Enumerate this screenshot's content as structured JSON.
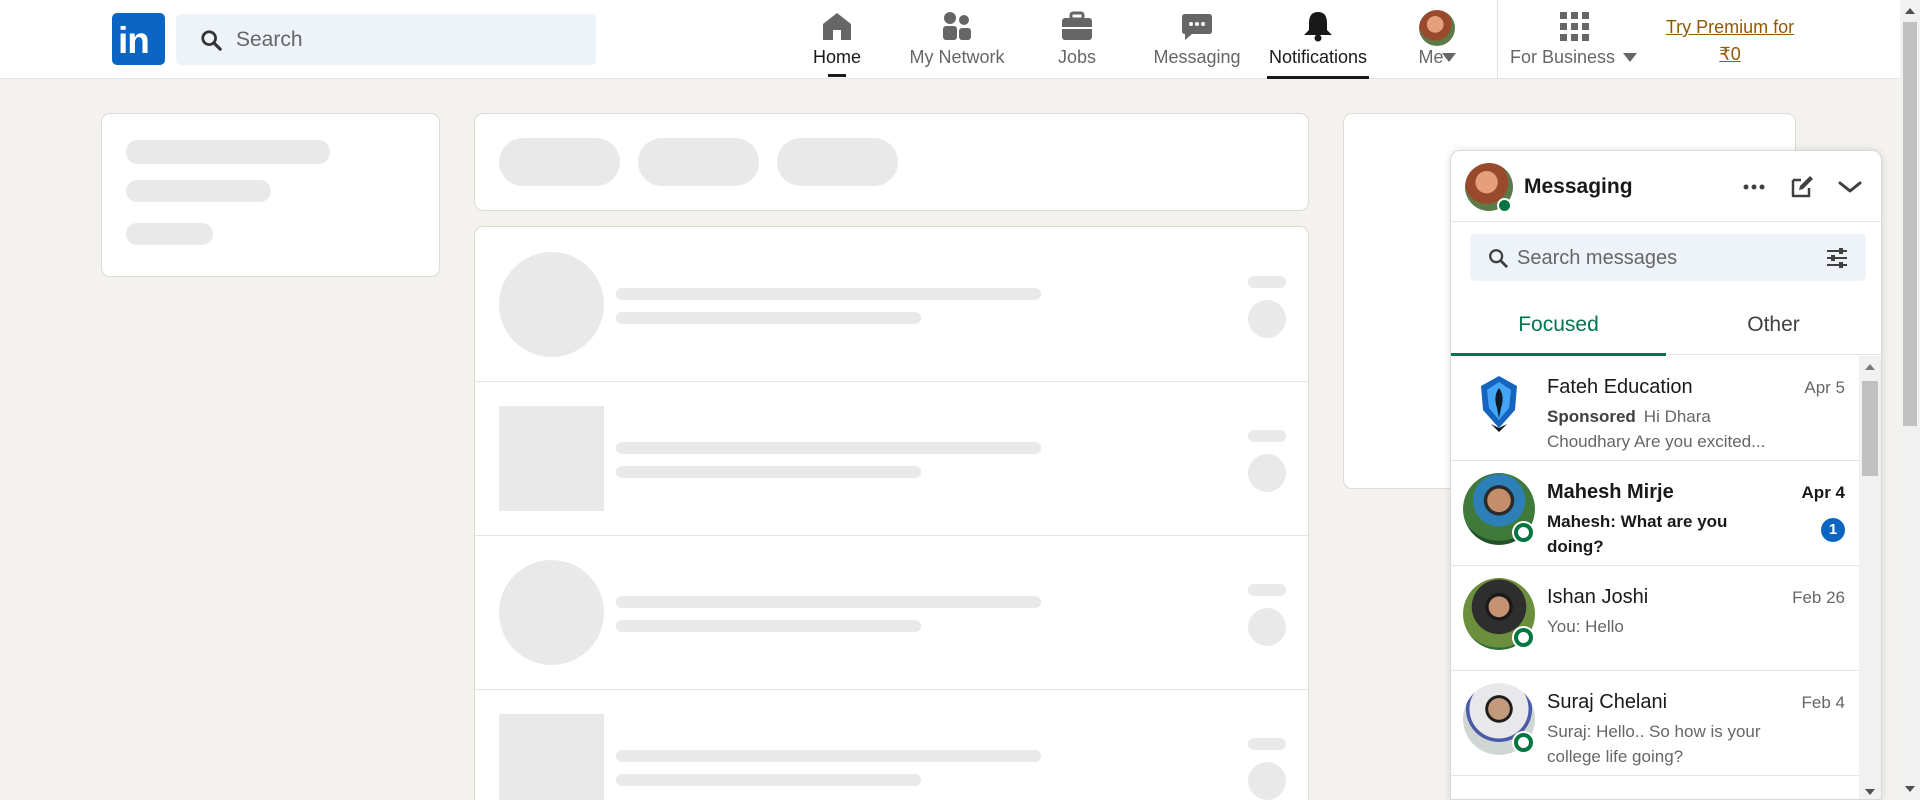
{
  "header": {
    "logo_text": "in",
    "search_placeholder": "Search",
    "nav": [
      {
        "label": "Home",
        "icon": "home-icon"
      },
      {
        "label": "My Network",
        "icon": "people-icon"
      },
      {
        "label": "Jobs",
        "icon": "briefcase-icon"
      },
      {
        "label": "Messaging",
        "icon": "chat-icon"
      },
      {
        "label": "Notifications",
        "icon": "bell-icon"
      },
      {
        "label": "Me",
        "icon": "avatar"
      },
      {
        "label": "For Business",
        "icon": "grid-icon"
      }
    ],
    "premium_line1": "Try Premium for",
    "premium_line2": "₹0"
  },
  "messaging": {
    "title": "Messaging",
    "search_placeholder": "Search messages",
    "tabs": [
      {
        "label": "Focused",
        "active": true
      },
      {
        "label": "Other",
        "active": false
      }
    ],
    "conversations": [
      {
        "name": "Fateh Education",
        "date": "Apr 5",
        "sponsored": "Sponsored",
        "preview": "Hi Dhara Choudhary Are you excited..."
      },
      {
        "name": "Mahesh Mirje",
        "date": "Apr 4",
        "preview": "Mahesh: What are you doing?",
        "unread_count": "1"
      },
      {
        "name": "Ishan Joshi",
        "date": "Feb 26",
        "preview": "You: Hello"
      },
      {
        "name": "Suraj Chelani",
        "date": "Feb 4",
        "preview": "Suraj: Hello.. So how is your college life going?"
      }
    ]
  },
  "colors": {
    "brand": "#0a66c2",
    "accent_green": "#01754f",
    "premium": "#915907",
    "page_bg": "#f4f2ee"
  }
}
